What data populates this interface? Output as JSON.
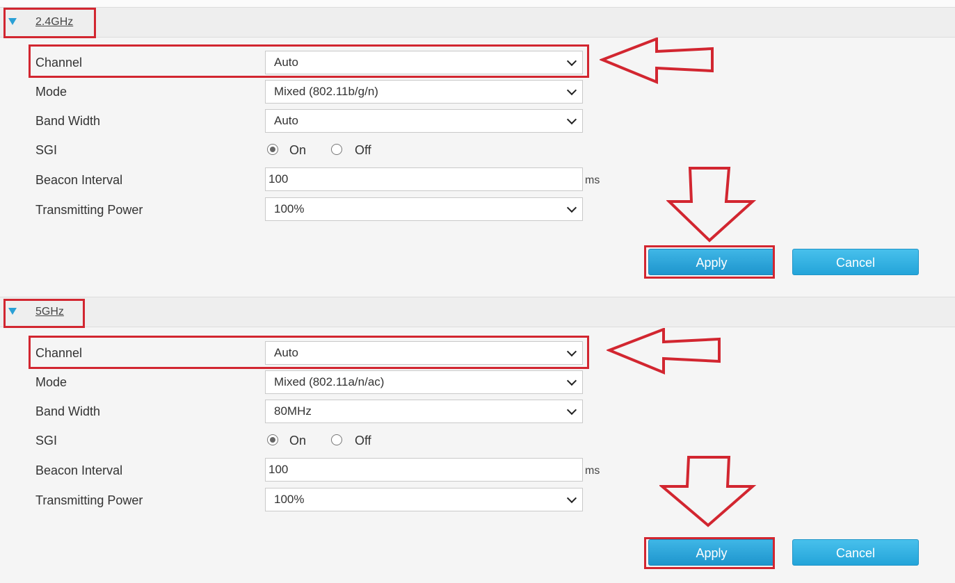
{
  "sections": [
    {
      "title": "2.4GHz",
      "rows": {
        "channel": {
          "label": "Channel",
          "value": "Auto"
        },
        "mode": {
          "label": "Mode",
          "value": "Mixed (802.11b/g/n)"
        },
        "bandwidth": {
          "label": "Band Width",
          "value": "Auto"
        },
        "sgi": {
          "label": "SGI",
          "on": "On",
          "off": "Off",
          "selected": "On"
        },
        "beacon": {
          "label": "Beacon Interval",
          "value": "100",
          "unit": "ms"
        },
        "power": {
          "label": "Transmitting Power",
          "value": "100%"
        }
      },
      "apply": "Apply",
      "cancel": "Cancel"
    },
    {
      "title": "5GHz",
      "rows": {
        "channel": {
          "label": "Channel",
          "value": "Auto"
        },
        "mode": {
          "label": "Mode",
          "value": "Mixed (802.11a/n/ac)"
        },
        "bandwidth": {
          "label": "Band Width",
          "value": "80MHz"
        },
        "sgi": {
          "label": "SGI",
          "on": "On",
          "off": "Off",
          "selected": "On"
        },
        "beacon": {
          "label": "Beacon Interval",
          "value": "100",
          "unit": "ms"
        },
        "power": {
          "label": "Transmitting Power",
          "value": "100%"
        }
      },
      "apply": "Apply",
      "cancel": "Cancel"
    }
  ],
  "colors": {
    "accent": "#2aa0d6",
    "highlight": "#d22630",
    "button": "#1e95cd"
  },
  "icons": {
    "section_toggle": "triangle-down-icon",
    "dropdown": "chevron-down-icon",
    "annotation": "outline-arrow-icon"
  }
}
